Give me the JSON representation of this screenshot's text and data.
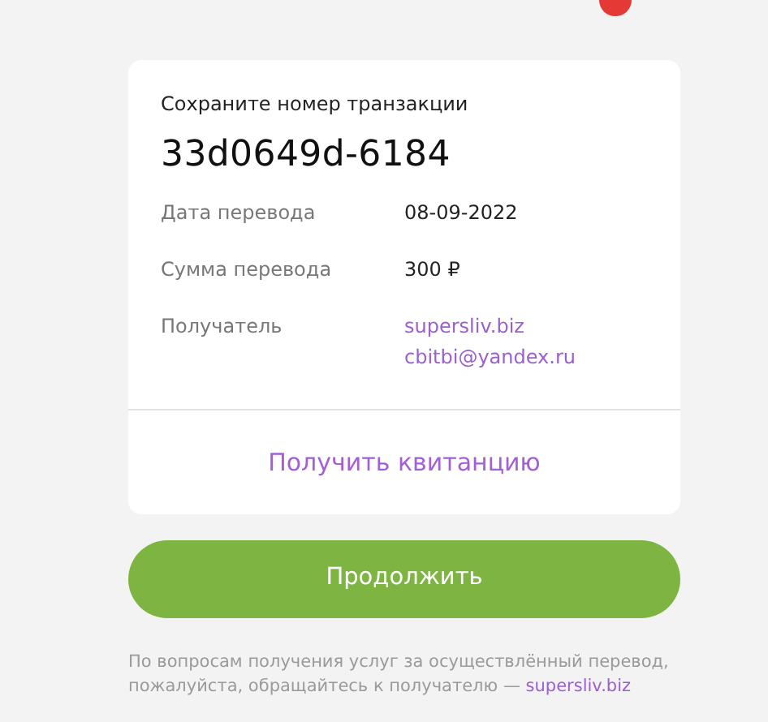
{
  "notification_dot": {
    "color": "#e53935"
  },
  "card": {
    "caption": "Сохраните номер транзакции",
    "transaction_id": "33d0649d-6184",
    "details": [
      {
        "label": "Дата перевода",
        "values": [
          "08-09-2022"
        ],
        "kind": "text"
      },
      {
        "label": "Сумма перевода",
        "values": [
          "300 ₽"
        ],
        "kind": "text"
      },
      {
        "label": "Получатель",
        "values": [
          "supersliv.biz",
          "cbitbi@yandex.ru"
        ],
        "kind": "link"
      }
    ],
    "receipt_link": "Получить квитанцию"
  },
  "continue_button": "Продолжить",
  "footnote": {
    "text": "По вопросам получения услуг за осуществлённый перевод, пожалуйста, обращайтесь к получателю — ",
    "link": "supersliv.biz"
  }
}
